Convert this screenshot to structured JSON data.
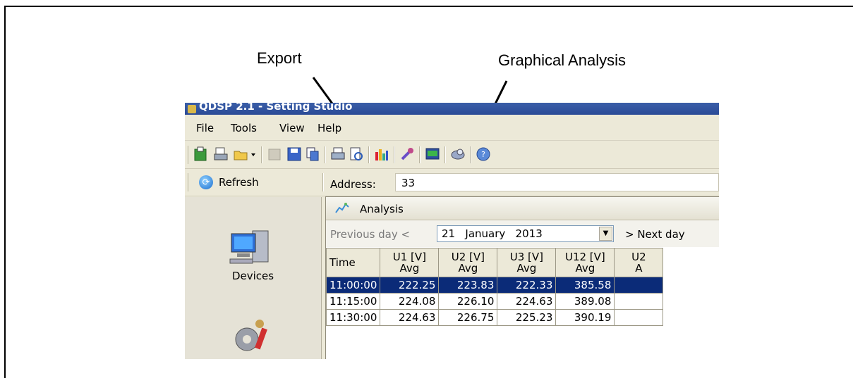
{
  "callouts": {
    "export": "Export",
    "graphical_analysis": "Graphical Analysis"
  },
  "window": {
    "title": "QDSP 2.1 - Setting Studio"
  },
  "menu": [
    {
      "label": "File"
    },
    {
      "label": "Tools"
    },
    {
      "label": "View"
    },
    {
      "label": "Help"
    }
  ],
  "toolbar": {
    "icons": [
      "new-device-icon",
      "print-setup-icon",
      "open-icon",
      "dropdown-arrow-icon",
      "disabled-import-icon",
      "save-icon",
      "export-icon",
      "print-icon",
      "print-preview-icon",
      "graphical-analysis-icon",
      "settings-tool-icon",
      "monitor-icon",
      "support-icon",
      "about-icon"
    ]
  },
  "toolbar2": {
    "refresh_label": "Refresh",
    "address_label": "Address:",
    "address_value": "33"
  },
  "sidebar": {
    "devices_label": "Devices"
  },
  "analysis": {
    "title": "Analysis",
    "prev_label": "Previous day <",
    "date_value": "21   January   2013",
    "next_label": "> Next day",
    "columns": [
      "Time",
      "U1 [V]\nAvg",
      "U2 [V]\nAvg",
      "U3 [V]\nAvg",
      "U12 [V]\nAvg",
      "U2\nA"
    ],
    "rows": [
      [
        "11:00:00",
        "222.25",
        "223.83",
        "222.33",
        "385.58",
        ""
      ],
      [
        "11:15:00",
        "224.08",
        "226.10",
        "224.63",
        "389.08",
        ""
      ],
      [
        "11:30:00",
        "224.63",
        "226.75",
        "225.23",
        "390.19",
        ""
      ]
    ]
  },
  "colors": {
    "title_bar": "#2a4a96",
    "selection": "#0b2b78",
    "chrome": "#ece9d8"
  }
}
